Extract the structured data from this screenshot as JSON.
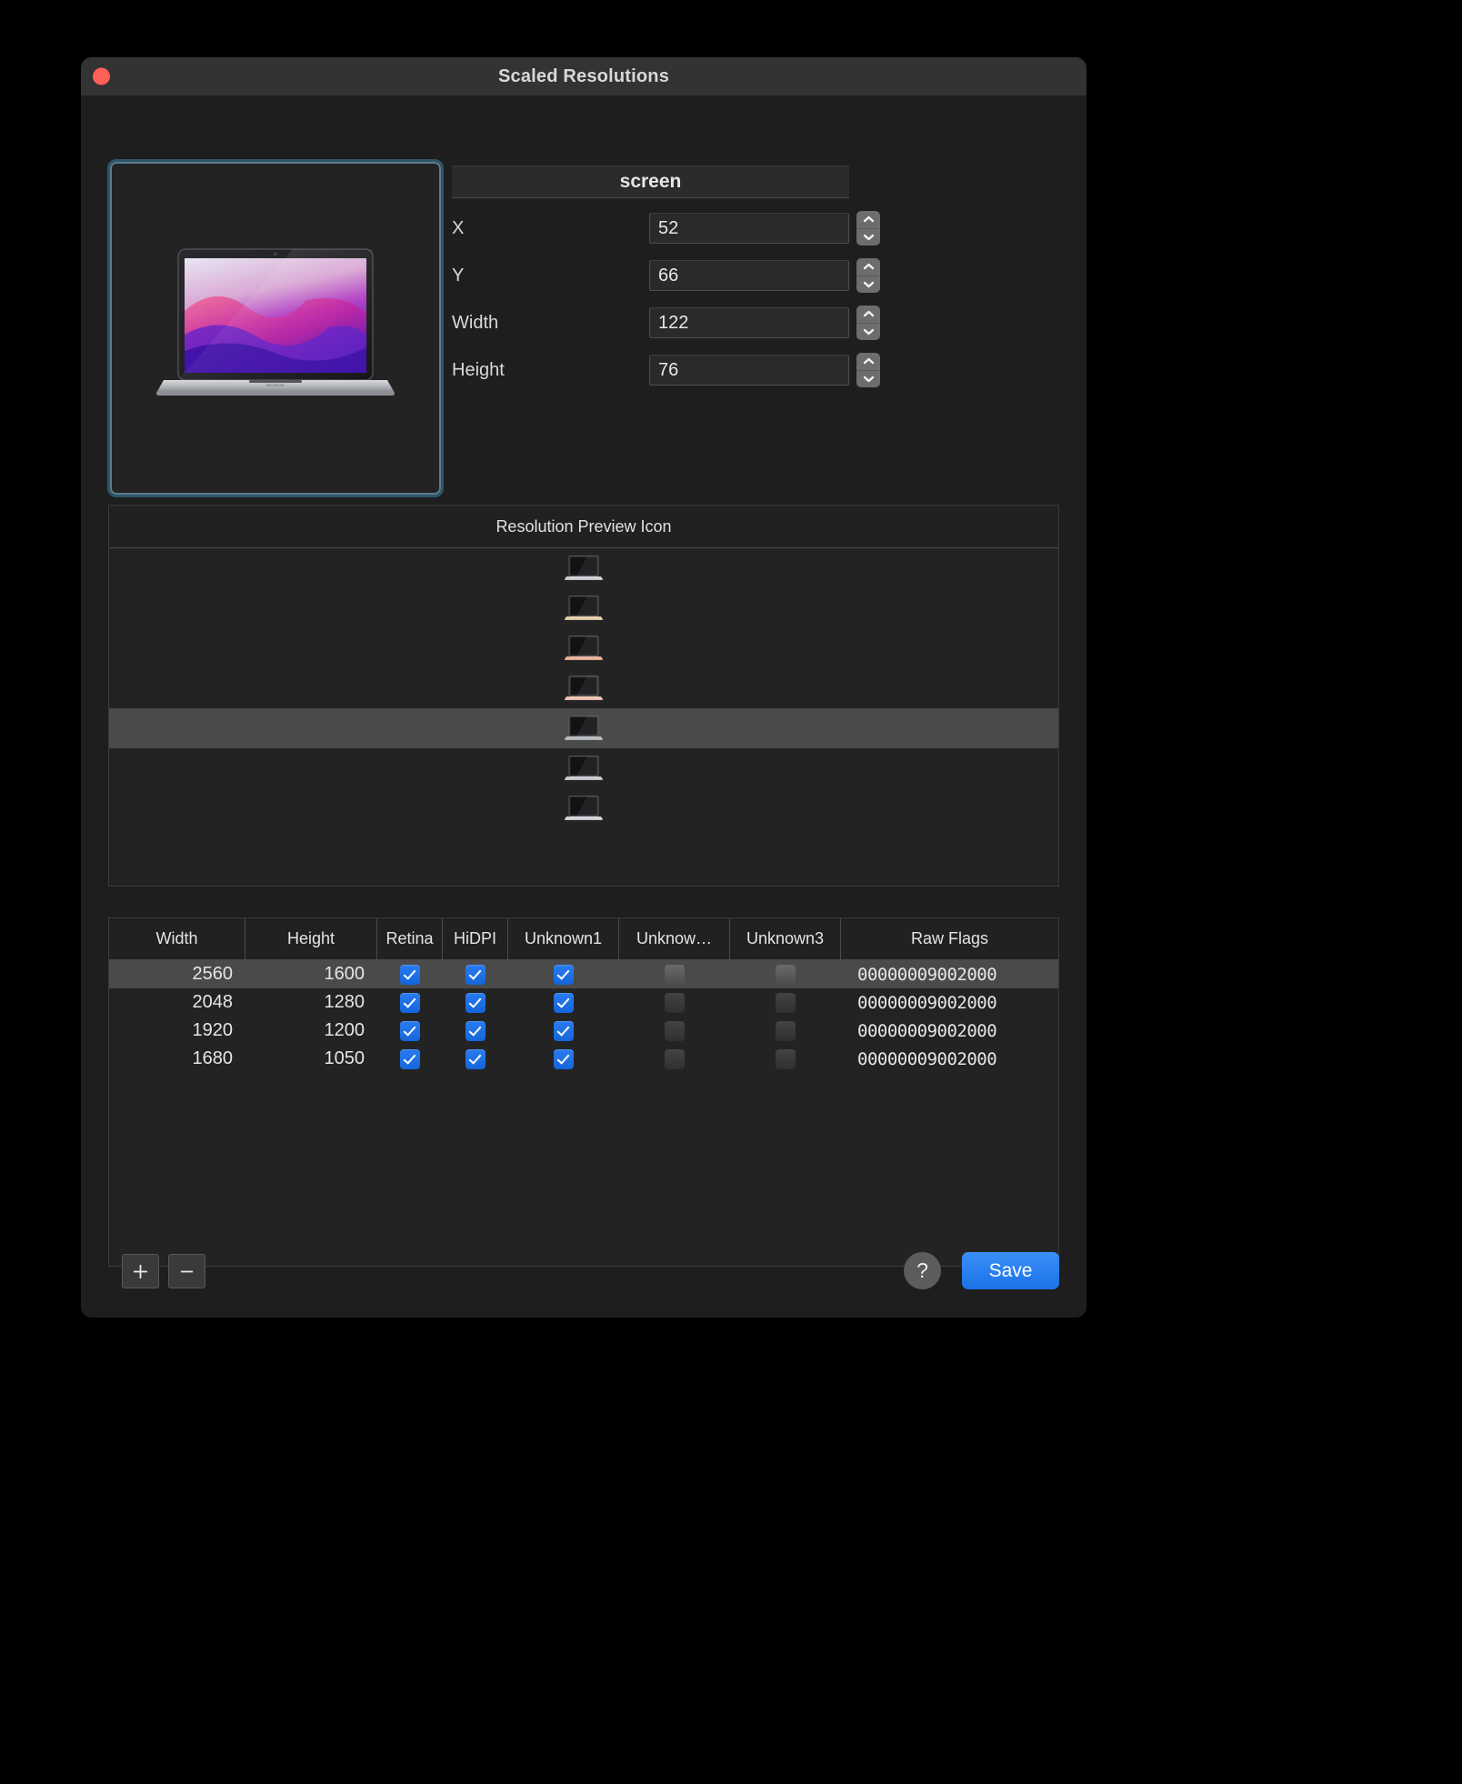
{
  "window": {
    "title": "Scaled Resolutions",
    "close_label": "●"
  },
  "preview": {
    "device_icon": "macbook-icon",
    "wallpaper": "macos-monterey-wallpaper"
  },
  "form": {
    "header": "screen",
    "fields": [
      {
        "label": "X",
        "value": "52"
      },
      {
        "label": "Y",
        "value": "66"
      },
      {
        "label": "Width",
        "value": "122"
      },
      {
        "label": "Height",
        "value": "76"
      }
    ],
    "stepper_up_icon": "chevron-up-icon",
    "stepper_down_icon": "chevron-down-icon"
  },
  "icon_list": {
    "header": "Resolution Preview Icon",
    "rows": [
      {
        "icon": "macbook-silver-icon",
        "selected": false
      },
      {
        "icon": "macbook-gold-icon",
        "selected": false
      },
      {
        "icon": "macbook-rosegold-icon",
        "selected": false
      },
      {
        "icon": "macbook-rosegold-open-icon",
        "selected": false
      },
      {
        "icon": "macbook-space-gray-icon",
        "selected": true
      },
      {
        "icon": "macbook-silver-thin-icon",
        "selected": false
      },
      {
        "icon": "macbook-silver-wide-icon",
        "selected": false
      }
    ]
  },
  "table": {
    "columns": [
      "Width",
      "Height",
      "Retina",
      "HiDPI",
      "Unknown1",
      "Unknow…",
      "Unknown3",
      "Raw Flags"
    ],
    "rows": [
      {
        "width": "2560",
        "height": "1600",
        "retina": true,
        "hidpi": true,
        "unknown1": true,
        "unknown2": false,
        "unknown3": false,
        "raw_flags": "00000009002000",
        "selected": true
      },
      {
        "width": "2048",
        "height": "1280",
        "retina": true,
        "hidpi": true,
        "unknown1": true,
        "unknown2": false,
        "unknown3": false,
        "raw_flags": "00000009002000",
        "selected": false
      },
      {
        "width": "1920",
        "height": "1200",
        "retina": true,
        "hidpi": true,
        "unknown1": true,
        "unknown2": false,
        "unknown3": false,
        "raw_flags": "00000009002000",
        "selected": false
      },
      {
        "width": "1680",
        "height": "1050",
        "retina": true,
        "hidpi": true,
        "unknown1": true,
        "unknown2": false,
        "unknown3": false,
        "raw_flags": "00000009002000",
        "selected": false
      }
    ]
  },
  "footer": {
    "add_label": "+",
    "remove_label": "−",
    "help_label": "?",
    "save_label": "Save"
  },
  "colors": {
    "accent": "#1a73e8",
    "close": "#ff6159",
    "focus_ring": "#2e5468",
    "selection": "#4a4a4a"
  }
}
